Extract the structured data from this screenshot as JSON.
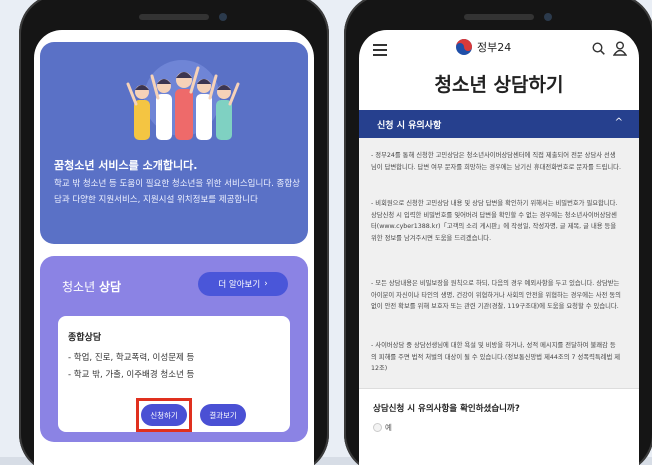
{
  "left": {
    "intro_title": "꿈청소년 서비스를 소개합니다.",
    "intro_desc": "학교 밖 청소년 등 도움이 필요한 청소년을 위한 서비스입니다. 종합상담과 다양한 지원서비스, 지원시설 위치정보를 제공합니다",
    "counsel_title_prefix": "청소년 ",
    "counsel_title_bold": "상담",
    "more_label": "더 알아보기",
    "more_icon": "chevron-right-icon",
    "inner_title": "종합상담",
    "items": [
      "학업, 진로, 학교폭력, 이성문제 등",
      "학교 밖, 가출, 이주배경 청소년 등"
    ],
    "apply_label": "신청하기",
    "result_label": "결과보기",
    "highlight_color": "#e0301e"
  },
  "right": {
    "logo_text": "정부24",
    "page_title": "청소년 상담하기",
    "notice_title": "신청 시 유의사항",
    "notice_chevron": "^",
    "notice_paragraphs": [
      "- 정부24를 통해 신청한 고민상담은 청소년사이버상담센터에 직접 제출되어 전문 상담사 선생님이 답변합니다. 답변 여부 문자를 희망하는 경우에는 남기신 휴대전화번호로 문자를 드립니다.",
      "- 비회원으로 신청한 고민상담 내용 및 상담 답변을 확인하기 위해서는 비밀번호가 필요합니다. 상담신청 시 입력한 비밀번호를 잊어버려 답변을 확인할 수 없는 경우에는 청소년사이버상담센터(www.cyber1388.kr)「고객의 소리 게시판」에 작성일, 작성자명, 글 제목, 글 내용 등을 위한 정보를 남겨주시면 도움을 드리겠습니다.",
      "- 모든 상담내용은 비밀보장을 원칙으로 하되, 다음의 경우 예외사항을 두고 있습니다. 상담받는 아이분이 자신이나 타인의 생명, 건강이 위협하거나 사회의 안전을 위협하는 경우에는 사전 동의 없이 안전 확보를 위해 보호자 또는 관련 기관(경찰, 119구조대)에 도움을 요청할 수 있습니다.",
      "- 사이버상담 중 상담선생님에 대한 욕설 및 비방을 하거나, 성적 메시지를 전달하여 불쾌감 등의 피해를 주면 법적 처벌의 대상이 될 수 있습니다.(정보통신망법 제44조의 7 성폭력특례법 제12조)"
    ],
    "question": "상담신청 시 유의사항을 확인하셨습니까?",
    "yes_label": "예"
  }
}
